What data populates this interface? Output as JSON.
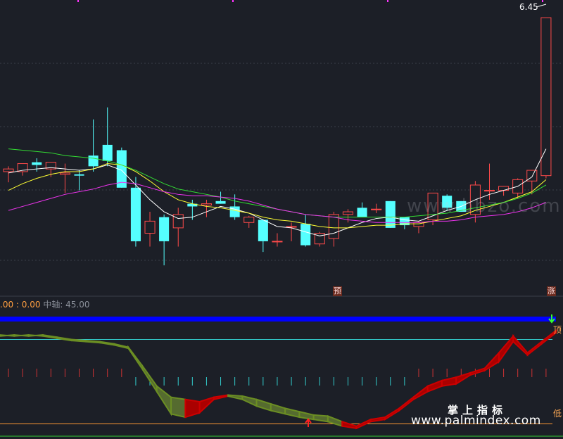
{
  "chart_data": [
    {
      "type": "candlestick",
      "title": "",
      "price_label": "6.45",
      "ylim": [
        4.46,
        6.52
      ],
      "candles": [
        {
          "o": 5.28,
          "h": 5.32,
          "l": 5.2,
          "c": 5.3
        },
        {
          "o": 5.28,
          "h": 5.33,
          "l": 5.25,
          "c": 5.34
        },
        {
          "o": 5.35,
          "h": 5.38,
          "l": 5.28,
          "c": 5.33
        },
        {
          "o": 5.3,
          "h": 5.34,
          "l": 5.24,
          "c": 5.35
        },
        {
          "o": 5.26,
          "h": 5.34,
          "l": 5.12,
          "c": 5.27
        },
        {
          "o": 5.26,
          "h": 5.29,
          "l": 5.14,
          "c": 5.25
        },
        {
          "o": 5.4,
          "h": 5.67,
          "l": 5.28,
          "c": 5.32
        },
        {
          "o": 5.48,
          "h": 5.76,
          "l": 5.32,
          "c": 5.36
        },
        {
          "o": 5.44,
          "h": 5.46,
          "l": 5.16,
          "c": 5.16
        },
        {
          "o": 5.16,
          "h": 5.24,
          "l": 4.72,
          "c": 4.76
        },
        {
          "o": 4.82,
          "h": 4.98,
          "l": 4.72,
          "c": 4.91
        },
        {
          "o": 4.94,
          "h": 4.96,
          "l": 4.58,
          "c": 4.76
        },
        {
          "o": 4.86,
          "h": 5.01,
          "l": 4.72,
          "c": 4.96
        },
        {
          "o": 5.04,
          "h": 5.07,
          "l": 4.92,
          "c": 5.02
        },
        {
          "o": 5.03,
          "h": 5.07,
          "l": 4.94,
          "c": 5.04
        },
        {
          "o": 5.06,
          "h": 5.13,
          "l": 5.04,
          "c": 5.04
        },
        {
          "o": 5.02,
          "h": 5.11,
          "l": 4.92,
          "c": 4.94
        },
        {
          "o": 4.9,
          "h": 4.95,
          "l": 4.86,
          "c": 4.94
        },
        {
          "o": 4.92,
          "h": 4.92,
          "l": 4.68,
          "c": 4.76
        },
        {
          "o": 4.76,
          "h": 4.82,
          "l": 4.72,
          "c": 4.76
        },
        {
          "o": 4.87,
          "h": 4.9,
          "l": 4.76,
          "c": 4.87
        },
        {
          "o": 4.89,
          "h": 4.96,
          "l": 4.72,
          "c": 4.73
        },
        {
          "o": 4.74,
          "h": 4.83,
          "l": 4.72,
          "c": 4.82
        },
        {
          "o": 4.78,
          "h": 4.98,
          "l": 4.72,
          "c": 4.96
        },
        {
          "o": 4.96,
          "h": 5.0,
          "l": 4.9,
          "c": 4.98
        },
        {
          "o": 5.01,
          "h": 5.05,
          "l": 4.94,
          "c": 4.94
        },
        {
          "o": 5.0,
          "h": 5.04,
          "l": 4.97,
          "c": 5.0
        },
        {
          "o": 5.06,
          "h": 5.06,
          "l": 4.86,
          "c": 4.86
        },
        {
          "o": 4.94,
          "h": 4.91,
          "l": 4.85,
          "c": 4.88
        },
        {
          "o": 4.87,
          "h": 4.91,
          "l": 4.82,
          "c": 4.9
        },
        {
          "o": 4.92,
          "h": 5.12,
          "l": 4.88,
          "c": 5.12
        },
        {
          "o": 5.1,
          "h": 5.11,
          "l": 4.99,
          "c": 5.01
        },
        {
          "o": 5.06,
          "h": 5.06,
          "l": 4.98,
          "c": 4.98
        },
        {
          "o": 4.96,
          "h": 5.21,
          "l": 4.9,
          "c": 5.18
        },
        {
          "o": 5.14,
          "h": 5.34,
          "l": 5.07,
          "c": 5.14
        },
        {
          "o": 5.14,
          "h": 5.16,
          "l": 5.1,
          "c": 5.17
        },
        {
          "o": 5.12,
          "h": 5.23,
          "l": 5.08,
          "c": 5.22
        },
        {
          "o": 5.21,
          "h": 5.28,
          "l": 5.11,
          "c": 5.29
        },
        {
          "o": 5.25,
          "h": 6.43,
          "l": 5.23,
          "c": 6.43
        }
      ],
      "ma_lines": [
        {
          "color": "#ffffff",
          "values": [
            5.27,
            5.29,
            5.3,
            5.31,
            5.3,
            5.29,
            5.3,
            5.33,
            5.29,
            5.18,
            5.07,
            4.98,
            4.93,
            4.94,
            4.98,
            5.02,
            5.0,
            4.97,
            4.92,
            4.87,
            4.86,
            4.83,
            4.8,
            4.82,
            4.86,
            4.9,
            4.93,
            4.94,
            4.92,
            4.91,
            4.95,
            4.99,
            5.02,
            5.07,
            5.11,
            5.14,
            5.17,
            5.24,
            5.45
          ]
        },
        {
          "color": "#ffff33",
          "values": [
            5.14,
            5.19,
            5.23,
            5.26,
            5.28,
            5.28,
            5.3,
            5.34,
            5.33,
            5.28,
            5.21,
            5.13,
            5.07,
            5.04,
            5.02,
            5.01,
            4.99,
            4.97,
            4.94,
            4.92,
            4.91,
            4.89,
            4.87,
            4.86,
            4.86,
            4.87,
            4.88,
            4.88,
            4.89,
            4.89,
            4.91,
            4.93,
            4.95,
            4.99,
            5.02,
            5.05,
            5.09,
            5.13,
            5.22
          ]
        },
        {
          "color": "#33dd33",
          "values": [
            5.45,
            5.44,
            5.43,
            5.42,
            5.4,
            5.39,
            5.38,
            5.36,
            5.33,
            5.29,
            5.24,
            5.19,
            5.15,
            5.13,
            5.11,
            5.09,
            5.06,
            5.04,
            5.02,
            5.0,
            4.98,
            4.96,
            4.95,
            4.94,
            4.94,
            4.94,
            4.94,
            4.94,
            4.94,
            4.95,
            4.96,
            4.97,
            4.99,
            5.01,
            5.03,
            5.05,
            5.08,
            5.12,
            5.18
          ]
        },
        {
          "color": "#ee33ee",
          "values": [
            4.99,
            5.02,
            5.05,
            5.08,
            5.11,
            5.13,
            5.15,
            5.18,
            5.2,
            5.19,
            5.16,
            5.13,
            5.11,
            5.1,
            5.1,
            5.09,
            5.08,
            5.06,
            5.03,
            5.0,
            4.98,
            4.96,
            4.95,
            4.94,
            4.92,
            4.91,
            4.9,
            4.9,
            4.9,
            4.9,
            4.91,
            4.91,
            4.92,
            4.94,
            4.95,
            4.96,
            4.98,
            5.01,
            5.05
          ]
        }
      ],
      "markers": [
        {
          "index": 23,
          "label": "预"
        },
        {
          "index": 38,
          "label": "涨"
        }
      ]
    },
    {
      "type": "area",
      "legend": {
        "values_text": ".00 : 0.00",
        "mid_label": "中轴: 45.00"
      },
      "ylim": [
        0,
        100
      ],
      "levels": [
        {
          "name": "顶",
          "value": 82,
          "color": "#33cccc"
        },
        {
          "name": "低",
          "value": 6,
          "color": "#ff9933"
        },
        {
          "name": "",
          "value": 100,
          "color": "#0000ff"
        }
      ],
      "band_upper": [
        85,
        86,
        85,
        86,
        84,
        82,
        81,
        80,
        78,
        75,
        58,
        40,
        30,
        28,
        26,
        30,
        32,
        31,
        28,
        24,
        20,
        17,
        14,
        13,
        8,
        4,
        10,
        12,
        20,
        30,
        40,
        45,
        48,
        52,
        56,
        70,
        85,
        70,
        80,
        90
      ],
      "band_lower": [
        86,
        85,
        86,
        85,
        83,
        81,
        80,
        79,
        77,
        74,
        55,
        35,
        15,
        12,
        16,
        28,
        31,
        28,
        22,
        18,
        15,
        12,
        10,
        8,
        4,
        2,
        8,
        10,
        18,
        28,
        35,
        40,
        42,
        50,
        54,
        62,
        80,
        68,
        78,
        88
      ]
    }
  ],
  "tags": {
    "yu": "预",
    "zhang": "涨",
    "top": "顶",
    "low": "低"
  },
  "watermark": {
    "mid": "www.bbzo.com",
    "cn": "掌上指标",
    "url": "www.palmindex.com"
  }
}
